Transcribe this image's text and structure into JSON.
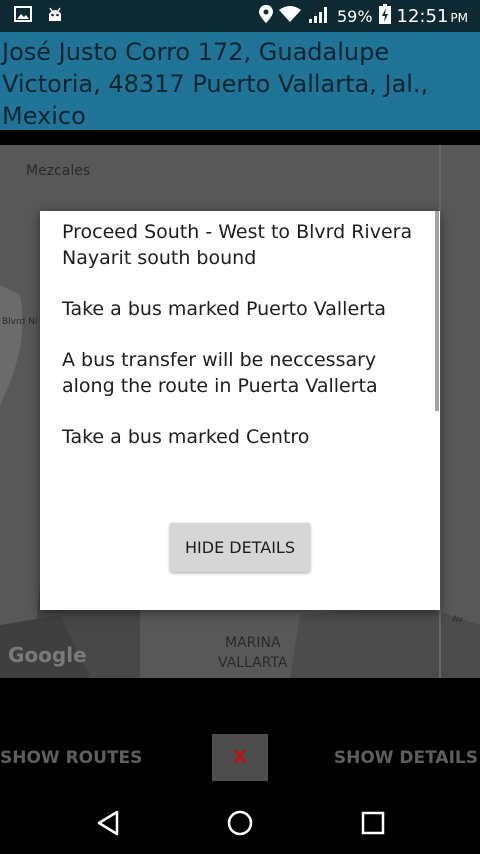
{
  "status_bar": {
    "battery_percent": "59%",
    "time": "12:51",
    "ampm": "PM"
  },
  "header": {
    "address": "José Justo Corro 172, Guadalupe Victoria, 48317 Puerto Vallarta, Jal., Mexico"
  },
  "map": {
    "labels": {
      "mezcales": "Mezcales",
      "blvrd": "Blvrd Ni",
      "marina": "MARINA",
      "vallarta": "VALLARTA",
      "av": "Av"
    },
    "logo": "Google"
  },
  "dialog": {
    "lines": [
      "Proceed  South - West to Blvrd Rivera Nayarit south bound",
      "Take a bus marked Puerto Vallerta",
      "A bus transfer will be neccessary along the route in Puerta Vallerta",
      "Take a bus marked Centro"
    ],
    "hide_label": "HIDE DETAILS"
  },
  "actions": {
    "routes_label": "SHOW ROUTES",
    "close_label": "X",
    "details_label": "SHOW DETAILS"
  },
  "colors": {
    "header_bg": "#1f7497",
    "status_bg": "#0d2a33",
    "close_x": "#c01010"
  }
}
